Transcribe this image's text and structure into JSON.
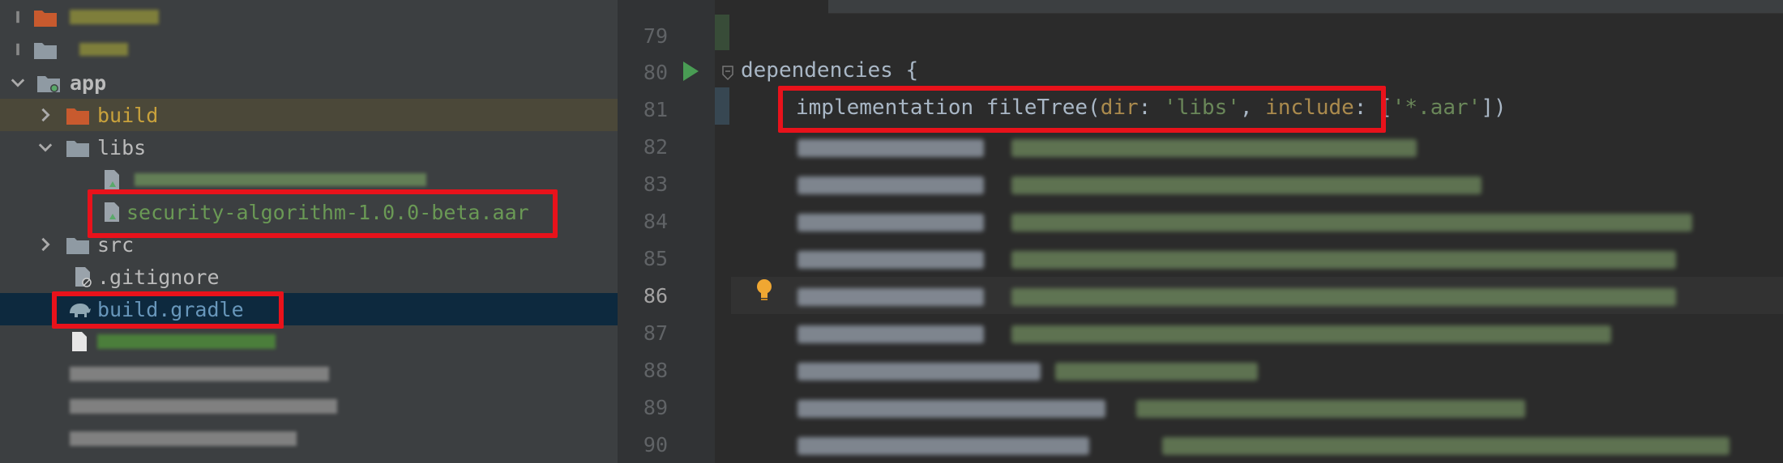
{
  "project_tree": {
    "items": [
      {
        "label": "app"
      },
      {
        "label": "build"
      },
      {
        "label": "libs"
      },
      {
        "label": "security-algorithm-1.0.0-beta.aar"
      },
      {
        "label": "src"
      },
      {
        "label": ".gitignore"
      },
      {
        "label": "build.gradle"
      }
    ]
  },
  "editor": {
    "line_numbers": [
      "79",
      "80",
      "81",
      "82",
      "83",
      "84",
      "85",
      "86",
      "87",
      "88",
      "89",
      "90"
    ],
    "code": {
      "deps_keyword": "dependencies",
      "open_brace": " {",
      "impl": "implementation",
      "fn": " fileTree(",
      "p_dir": "dir",
      "colon1": ": ",
      "s_libs": "'libs'",
      "comma": ", ",
      "p_include": "include",
      "colon2": ": [",
      "s_aar": "'*.aar'",
      "close": "])"
    }
  },
  "colors": {
    "highlight_box": "#e8121b",
    "run_icon": "#499c54",
    "bulb_icon": "#f0a732"
  }
}
